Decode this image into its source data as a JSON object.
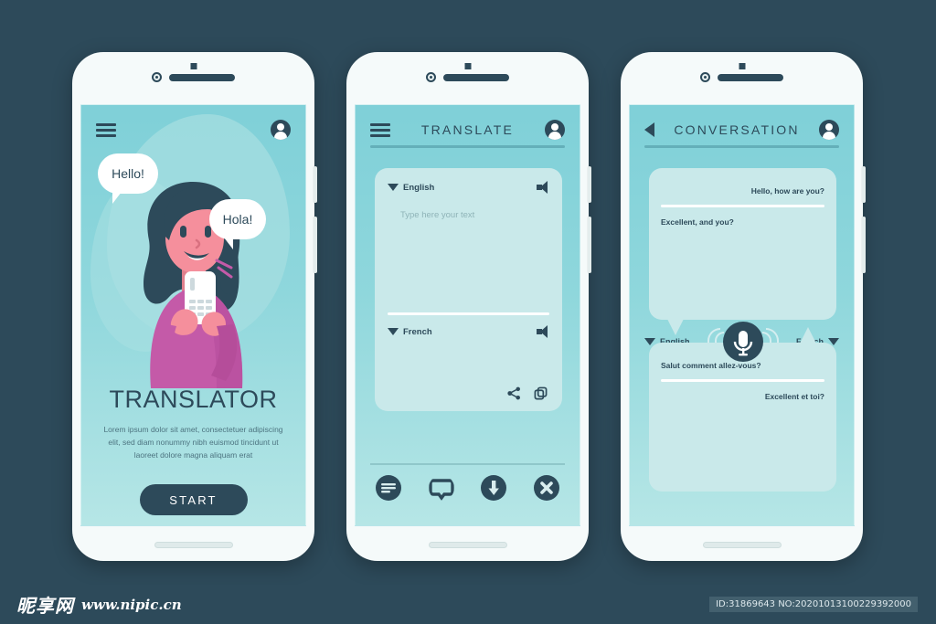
{
  "screens": [
    {
      "id": "home",
      "header": {
        "menu_icon": "hamburger-icon",
        "avatar_icon": "user-avatar-icon"
      },
      "bubbles": [
        {
          "text": "Hello!",
          "lang": "en"
        },
        {
          "text": "Hola!",
          "lang": "es"
        }
      ],
      "title": "TRANSLATOR",
      "description": "Lorem ipsum dolor sit amet, consectetuer adipiscing elit, sed diam nonummy nibh euismod tincidunt ut laoreet dolore magna aliquam erat",
      "start_button": "START"
    },
    {
      "id": "translate",
      "header": {
        "menu_icon": "hamburger-icon",
        "title": "TRANSLATE",
        "avatar_icon": "user-avatar-icon"
      },
      "source": {
        "language": "English",
        "placeholder": "Type here your text",
        "speaker_icon": "speaker-icon"
      },
      "target": {
        "language": "French",
        "speaker_icon": "speaker-icon"
      },
      "card_actions": [
        {
          "name": "share-icon",
          "label": "Share"
        },
        {
          "name": "copy-icon",
          "label": "Copy"
        }
      ],
      "bottom_nav": [
        {
          "name": "text-lines-icon",
          "label": "Text"
        },
        {
          "name": "chat-bubble-icon",
          "label": "Chat"
        },
        {
          "name": "download-icon",
          "label": "Download"
        },
        {
          "name": "close-icon",
          "label": "Close"
        }
      ]
    },
    {
      "id": "conversation",
      "header": {
        "back_icon": "back-arrow-icon",
        "title": "CONVERSATION",
        "avatar_icon": "user-avatar-icon"
      },
      "top_bubble": {
        "messages": [
          {
            "text": "Hello, how are you?",
            "align": "right"
          },
          {
            "text": "Excellent, and you?",
            "align": "left"
          }
        ]
      },
      "bottom_bubble": {
        "messages": [
          {
            "text": "Salut comment allez-vous?",
            "align": "left"
          },
          {
            "text": "Excellent et toi?",
            "align": "right"
          }
        ]
      },
      "left_language": "English",
      "right_language": "French",
      "mic_icon": "microphone-icon"
    }
  ],
  "footer": {
    "logo": "昵享网",
    "url": "www.nipic.cn",
    "id_text": "ID:31869643 NO:20201013100229392000"
  },
  "colors": {
    "page_bg": "#2d4a5a",
    "screen_top": "#7fd0d8",
    "screen_bottom": "#b6e6e6",
    "card": "#c9e9ea",
    "ink": "#2d4a5a",
    "frame": "#f5fafa",
    "accent_pink": "#c45aa8",
    "skin": "#f58f9c"
  }
}
